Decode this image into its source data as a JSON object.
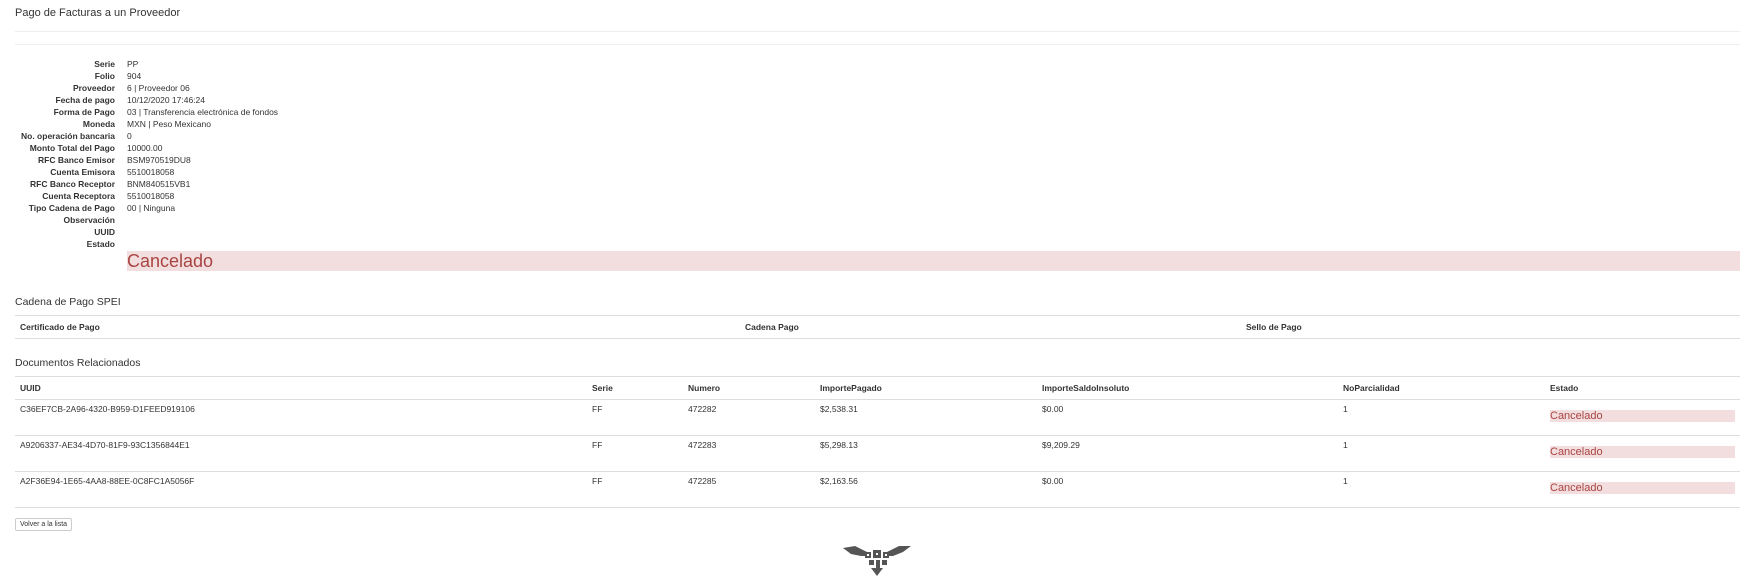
{
  "page_title": "Pago de Facturas a un Proveedor",
  "details": [
    {
      "label": "Serie",
      "value": "PP"
    },
    {
      "label": "Folio",
      "value": "904"
    },
    {
      "label": "Proveedor",
      "value": "6 | Proveedor 06"
    },
    {
      "label": "Fecha de pago",
      "value": "10/12/2020 17:46:24"
    },
    {
      "label": "Forma de Pago",
      "value": "03 | Transferencia electrónica de fondos"
    },
    {
      "label": "Moneda",
      "value": "MXN | Peso Mexicano"
    },
    {
      "label": "No. operación bancaria",
      "value": "0"
    },
    {
      "label": "Monto Total del Pago",
      "value": "10000.00"
    },
    {
      "label": "RFC Banco Emisor",
      "value": "BSM970519DU8"
    },
    {
      "label": "Cuenta Emisora",
      "value": "5510018058"
    },
    {
      "label": "RFC Banco Receptor",
      "value": "BNM840515VB1"
    },
    {
      "label": "Cuenta Receptora",
      "value": "5510018058"
    },
    {
      "label": "Tipo Cadena de Pago",
      "value": "00 | Ninguna"
    },
    {
      "label": "Observación",
      "value": ""
    },
    {
      "label": "UUID",
      "value": ""
    },
    {
      "label": "Estado",
      "value": ""
    }
  ],
  "estado_banner": "Cancelado",
  "spei": {
    "heading": "Cadena de Pago SPEI",
    "columns": [
      "Certificado de Pago",
      "Cadena Pago",
      "Sello de Pago"
    ]
  },
  "docs": {
    "heading": "Documentos Relacionados",
    "columns": [
      "UUID",
      "Serie",
      "Numero",
      "ImportePagado",
      "ImporteSaldoInsoluto",
      "NoParcialidad",
      "Estado"
    ],
    "rows": [
      {
        "uuid": "C36EF7CB-2A96-4320-B959-D1FEED919106",
        "serie": "FF",
        "numero": "472282",
        "pagado": "$2,538.31",
        "saldo": "$0.00",
        "parcialidad": "1",
        "estado": "Cancelado"
      },
      {
        "uuid": "A9206337-AE34-4D70-81F9-93C1356844E1",
        "serie": "FF",
        "numero": "472283",
        "pagado": "$5,298.13",
        "saldo": "$9,209.29",
        "parcialidad": "1",
        "estado": "Cancelado"
      },
      {
        "uuid": "A2F36E94-1E65-4AA8-88EE-0C8FC1A5056F",
        "serie": "FF",
        "numero": "472285",
        "pagado": "$2,163.56",
        "saldo": "$0.00",
        "parcialidad": "1",
        "estado": "Cancelado"
      }
    ]
  },
  "back_button": "Volver a la lista",
  "icons": {
    "logo": "eagle-qr-logo-icon"
  },
  "colors": {
    "danger_bg": "#f2dede",
    "danger_text": "#a94442"
  }
}
